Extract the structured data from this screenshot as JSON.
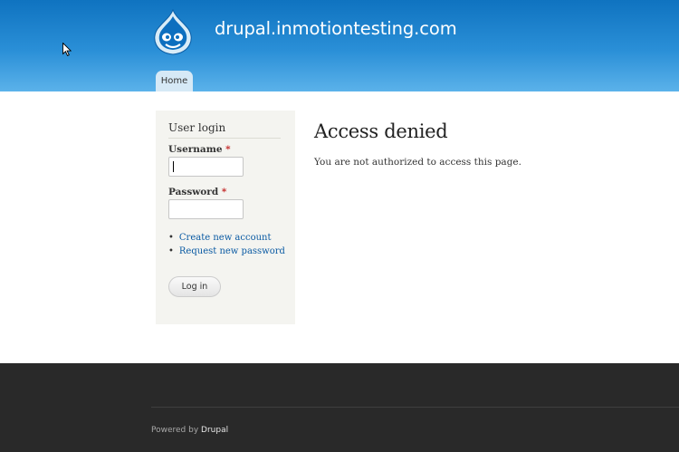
{
  "header": {
    "site_name": "drupal.inmotiontesting.com",
    "logo_icon": "drupal-drop-logo-icon",
    "tabs": [
      {
        "label": "Home"
      }
    ]
  },
  "sidebar": {
    "block_title": "User login",
    "username_label": "Username",
    "password_label": "Password",
    "required_marker": "*",
    "username_value": "",
    "password_value": "",
    "links": [
      {
        "label": "Create new account"
      },
      {
        "label": "Request new password"
      }
    ],
    "login_button": "Log in"
  },
  "main": {
    "title": "Access denied",
    "message": "You are not authorized to access this page."
  },
  "footer": {
    "powered_by_prefix": "Powered by",
    "powered_by_link": "Drupal"
  },
  "colors": {
    "header_top": "#0f73c0",
    "header_bottom": "#5bb2ea",
    "link": "#0a5aa3",
    "footer_bg": "#292929",
    "required": "#c22020"
  }
}
